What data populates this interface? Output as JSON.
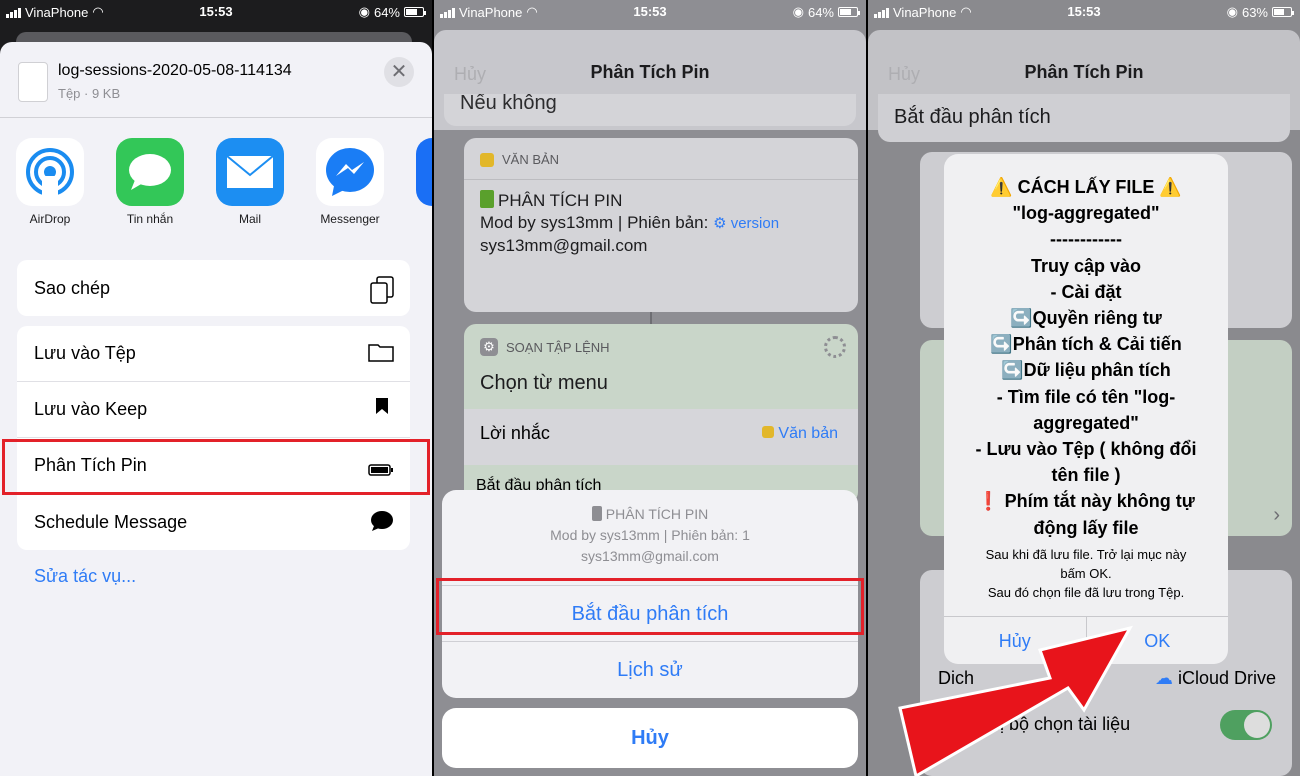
{
  "status_bars": [
    {
      "carrier": "VinaPhone",
      "time": "15:53",
      "battery": "64%"
    },
    {
      "carrier": "VinaPhone",
      "time": "15:53",
      "battery": "64%"
    },
    {
      "carrier": "VinaPhone",
      "time": "15:53",
      "battery": "63%"
    }
  ],
  "share": {
    "file_name": "log-sessions-2020-05-08-114134",
    "file_meta": "Tệp · 9 KB",
    "close": "✕",
    "apps": [
      "AirDrop",
      "Tin nhắn",
      "Mail",
      "Messenger"
    ],
    "actions": [
      "Sao chép",
      "Lưu vào Tệp",
      "Lưu vào Keep",
      "Phân Tích Pin",
      "Schedule Message"
    ],
    "edit": "Sửa tác vụ..."
  },
  "shortcut": {
    "cancel": "Hủy",
    "title": "Phân Tích Pin",
    "top_partial": "Nếu không",
    "text_card": {
      "header": "VĂN BẢN",
      "line1": "PHÂN TÍCH PIN",
      "line2": "Mod by sys13mm | Phiên bản:",
      "token": "version",
      "line3": "sys13mm@gmail.com"
    },
    "script_card": {
      "header": "SOẠN TẬP LỆNH",
      "title": "Chọn từ menu",
      "prompt": "Lời nhắc",
      "prompt_token": "Văn bản",
      "item": "Bắt đầu phân tích"
    },
    "sheet": {
      "title": "PHÂN TÍCH PIN",
      "line2": "Mod by sys13mm | Phiên bản: 1",
      "line3": "sys13mm@gmail.com",
      "btn1": "Bắt đầu phân tích",
      "btn2": "Lịch sử",
      "cancel": "Hủy"
    }
  },
  "alert_panel": {
    "cancel": "Hủy",
    "title": "Phân Tích Pin",
    "top_item": "Bắt đầu phân tích",
    "lines": [
      "⚠️ CÁCH LẤY FILE ⚠️",
      "\"log-aggregated\"",
      "------------",
      "Truy cập vào",
      "- Cài đặt",
      "↪️Quyền riêng tư",
      "↪️Phân tích & Cải tiến",
      "↪️Dữ liệu phân tích",
      "- Tìm file có tên \"log-",
      "aggregated\"",
      "- Lưu vào Tệp ( không đổi",
      "tên file )",
      "❗ Phím tắt này không tự",
      "động lấy file"
    ],
    "sub_lines": [
      "Sau khi đã lưu file. Trở lại mục này",
      "bấm OK.",
      "Sau đó chọn file đã lưu trong Tệp."
    ],
    "btn_left": "Hủy",
    "btn_ok": "OK",
    "bg_dich": "Dich",
    "bg_icloud": "iCloud Drive",
    "bg_bottom": "n thị bộ chọn tài liệu"
  },
  "colors": {
    "accent": "#2f7cf6",
    "highlight": "#e32129",
    "arrow": "#e8141b"
  }
}
